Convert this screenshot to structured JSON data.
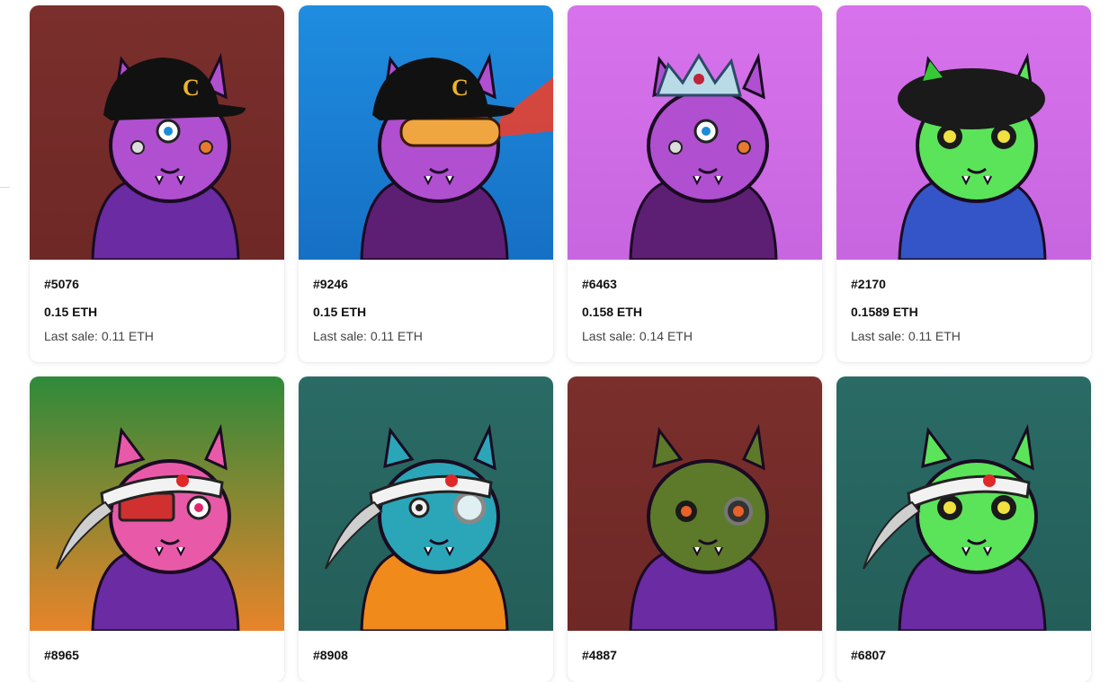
{
  "cards": [
    {
      "id": "#5076",
      "price": "0.15 ETH",
      "last_sale": "Last sale: 0.11 ETH",
      "bg": [
        "#7a2f2c",
        "#6e2826"
      ],
      "fur": "#b04fd0",
      "outfit": "#6a2ba3",
      "hat": "cap",
      "eyes": "normal",
      "accent": "#e84a3a"
    },
    {
      "id": "#9246",
      "price": "0.15 ETH",
      "last_sale": "Last sale: 0.11 ETH",
      "bg": [
        "#1f8de0",
        "#1670c4"
      ],
      "fur": "#b04fd0",
      "outfit": "#5d1f74",
      "hat": "cap",
      "eyes": "visor",
      "accent": "#e8402f"
    },
    {
      "id": "#6463",
      "price": "0.158 ETH",
      "last_sale": "Last sale: 0.14 ETH",
      "bg": [
        "#d772ec",
        "#c766e0"
      ],
      "fur": "#b04fd0",
      "outfit": "#5d1f74",
      "hat": "crown",
      "eyes": "normal",
      "accent": "#9fd6e8"
    },
    {
      "id": "#2170",
      "price": "0.1589 ETH",
      "last_sale": "Last sale: 0.11 ETH",
      "bg": [
        "#d772ec",
        "#c766e0"
      ],
      "fur": "#5be35a",
      "outfit": "#3355c8",
      "hat": "beret",
      "eyes": "radiation",
      "accent": "#f0e040"
    },
    {
      "id": "#8965",
      "bg": [
        "#2e8a3a",
        "#e8842a"
      ],
      "fur": "#e85aa8",
      "outfit": "#6a2ba3",
      "hat": "headband",
      "eyes": "cyber",
      "accent": "#e02828"
    },
    {
      "id": "#8908",
      "bg": [
        "#2a6b66",
        "#245e59"
      ],
      "fur": "#2aa6b8",
      "outfit": "#f08a1a",
      "hat": "headband",
      "eyes": "monocle",
      "accent": "#e02828"
    },
    {
      "id": "#4887",
      "bg": [
        "#7a2f2c",
        "#6e2826"
      ],
      "fur": "#5d7a2a",
      "outfit": "#6a2ba3",
      "hat": "none",
      "eyes": "zombie",
      "accent": "#e8602a"
    },
    {
      "id": "#6807",
      "bg": [
        "#2a6b66",
        "#245e59"
      ],
      "fur": "#5be35a",
      "outfit": "#6a2ba3",
      "hat": "headband",
      "eyes": "radiation",
      "accent": "#e02828"
    }
  ]
}
